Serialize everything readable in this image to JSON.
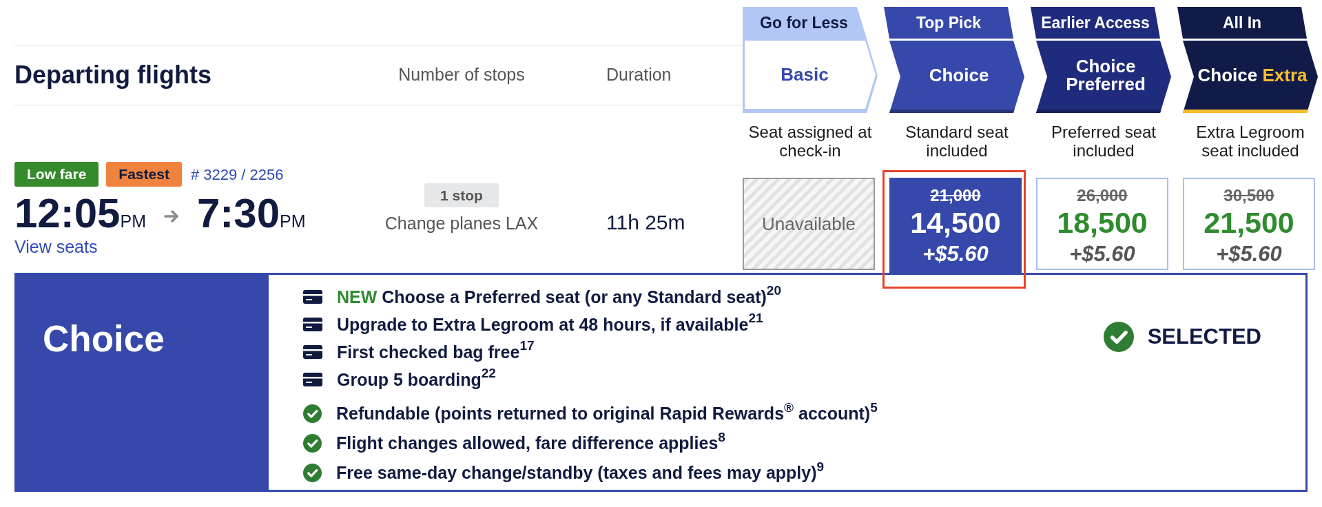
{
  "header": {
    "title": "Departing flights",
    "columns": [
      {
        "label": "Number of stops"
      },
      {
        "label": "Duration"
      }
    ]
  },
  "flight": {
    "badges": [
      {
        "label": "Low fare",
        "color": "#358a2c"
      },
      {
        "label": "Fastest",
        "color": "#f0843e"
      }
    ],
    "flight_number": "# 3229 / 2256",
    "depart_time": "12:05",
    "depart_period": "PM",
    "arrive_time": "7:30",
    "arrive_period": "PM",
    "link": "View seats",
    "stops": "1 stop",
    "stop_detail": "Change planes LAX",
    "duration": "11h 25m"
  },
  "fares": [
    {
      "kind": "outline",
      "color": "#b3c7f7",
      "tag": "Go for Less",
      "name": "Basic",
      "description": "Seat assigned at check-in",
      "unavailable_text": "Unavailable",
      "highlighted": false
    },
    {
      "kind": "filled",
      "color": "#3649ab",
      "tag": "Top Pick",
      "name": "Choice",
      "description": "Standard seat included",
      "price": {
        "old": "21,000",
        "points": "14,500",
        "fee": "+$5.60"
      },
      "selected": true,
      "highlighted": true
    },
    {
      "kind": "filled",
      "color": "#1f2b7c",
      "tag": "Earlier Access",
      "name": "Choice Preferred",
      "description": "Preferred seat included",
      "price": {
        "old": "26,000",
        "points": "18,500",
        "fee": "+$5.60"
      },
      "selected": false,
      "highlighted": false
    },
    {
      "kind": "filled",
      "color": "#121b47",
      "tag": "All In",
      "name": "Choice",
      "name_accent": "Extra",
      "description": "Extra Legroom seat included",
      "price": {
        "old": "30,500",
        "points": "21,500",
        "fee": "+$5.60"
      },
      "selected": false,
      "highlighted": false
    }
  ],
  "panel": {
    "title": "Choice",
    "features": [
      {
        "kind": "ticket",
        "tag": "NEW",
        "text": "Choose a Preferred seat (or any Standard seat)$^{20}$"
      },
      {
        "kind": "ticket",
        "text": "Upgrade to Extra Legroom at 48 hours, if available$^{21}$"
      },
      {
        "kind": "ticket",
        "text": "First checked bag free$^{17}$"
      },
      {
        "kind": "ticket",
        "text": "Group 5 boarding$^{22}$"
      },
      {
        "kind": "check",
        "text": "Refundable (points returned to original Rapid Rewards$^{®}$ account)$^{5}$"
      },
      {
        "kind": "check",
        "text": "Flight changes allowed, fare difference applies$^{8}$"
      },
      {
        "kind": "check",
        "text": "Free same-day change/standby (taxes and fees may apply)$^{9}$"
      }
    ],
    "status": "SELECTED"
  }
}
